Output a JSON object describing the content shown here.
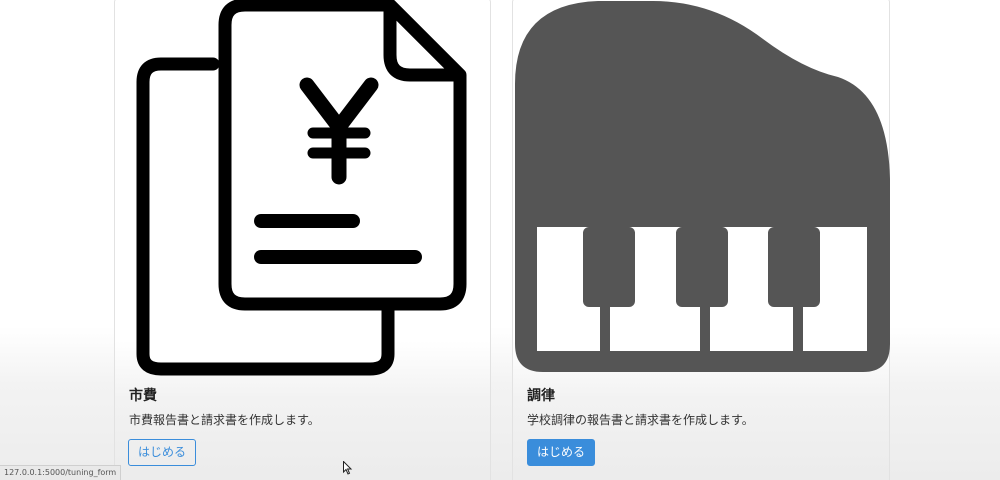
{
  "cards": [
    {
      "title": "市費",
      "description": "市費報告書と請求書を作成します。",
      "button_label": "はじめる",
      "icon": "yen-document-icon"
    },
    {
      "title": "調律",
      "description": "学校調律の報告書と請求書を作成します。",
      "button_label": "はじめる",
      "icon": "grand-piano-icon"
    }
  ],
  "status_bar": {
    "url": "127.0.0.1:5000/tuning_form"
  },
  "colors": {
    "accent": "#3a8ddb",
    "piano_gray": "#555555",
    "icon_black": "#000000"
  }
}
